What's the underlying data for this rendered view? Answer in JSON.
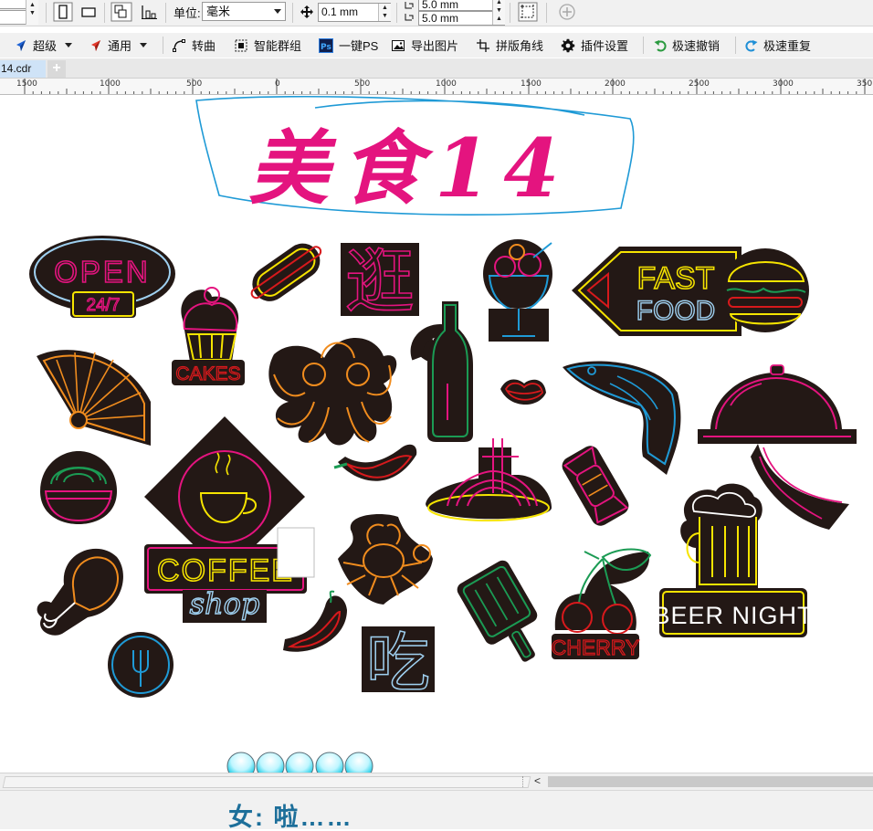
{
  "propbar": {
    "unit_label": "单位:",
    "unit_value": "毫米",
    "nudge_value": "0.1 mm",
    "dup_x_value": "5.0 mm",
    "dup_y_value": "5.0 mm",
    "icons": [
      "portrait-page-icon",
      "landscape-page-icon",
      "align-icon",
      "distribute-icon",
      "nudge-icon",
      "duplicate-offset-icon",
      "frame-icon",
      "add-circle-icon"
    ]
  },
  "toolbar": {
    "items": [
      {
        "label": "超级",
        "icon": "super-arrow-icon",
        "dropdown": true
      },
      {
        "label": "通用",
        "icon": "general-arrow-icon",
        "dropdown": true
      },
      {
        "label": "转曲",
        "icon": "convert-curve-icon"
      },
      {
        "label": "智能群组",
        "icon": "smart-group-icon"
      },
      {
        "label": "一键PS",
        "icon": "ps-icon"
      },
      {
        "label": "导出图片",
        "icon": "export-image-icon"
      },
      {
        "label": "拼版角线",
        "icon": "crop-marks-icon"
      },
      {
        "label": "插件设置",
        "icon": "gear-icon"
      },
      {
        "label": "极速撤销",
        "icon": "undo-icon"
      },
      {
        "label": "极速重复",
        "icon": "redo-icon"
      }
    ]
  },
  "tabs": {
    "document": "14.cdr",
    "add_label": "+"
  },
  "ruler": {
    "labels": [
      "1500",
      "1000",
      "500",
      "0",
      "500",
      "1000",
      "1500",
      "2000",
      "2500",
      "3000",
      "350"
    ]
  },
  "canvas": {
    "title": "美食14",
    "title_color": "#e4147f",
    "oval_color": "#1f9ad6",
    "sticker_base_color": "#231815",
    "neon_colors": {
      "pink": "#e4147f",
      "yellow": "#f6e400",
      "orange": "#f08c1e",
      "blue": "#1f9ad6",
      "green": "#1b9b54",
      "red": "#d7191c",
      "light_blue": "#9fd0f0"
    },
    "sticker_texts": {
      "open": "OPEN",
      "hours": "24/7",
      "cakes": "CAKES",
      "fast": "FAST",
      "food": "FOOD",
      "coffee": "COFFEE",
      "shop": "shop",
      "cherry": "CHERRY",
      "beer_night": "BEER NIGHT",
      "guang": "逛",
      "chi": "吃"
    },
    "stickers": [
      "open-24-7-sign",
      "hot-dog",
      "guang-character",
      "ice-cream-glass",
      "fast-food-sign",
      "burger",
      "folding-fan",
      "cupcake",
      "octopus",
      "wine-bottle",
      "lips",
      "fish",
      "serving-cloche",
      "chili-pepper",
      "noodle-bowl",
      "noodles-plate",
      "candy",
      "drumstick",
      "coffee-shop-sign",
      "crab",
      "grill-spatula",
      "cherry-sign",
      "beer-night-sign",
      "fork-badge",
      "red-chili",
      "chi-character"
    ]
  },
  "scrollbar": {
    "left_arrow": "<"
  },
  "status": {
    "text": "女: 啦……"
  }
}
